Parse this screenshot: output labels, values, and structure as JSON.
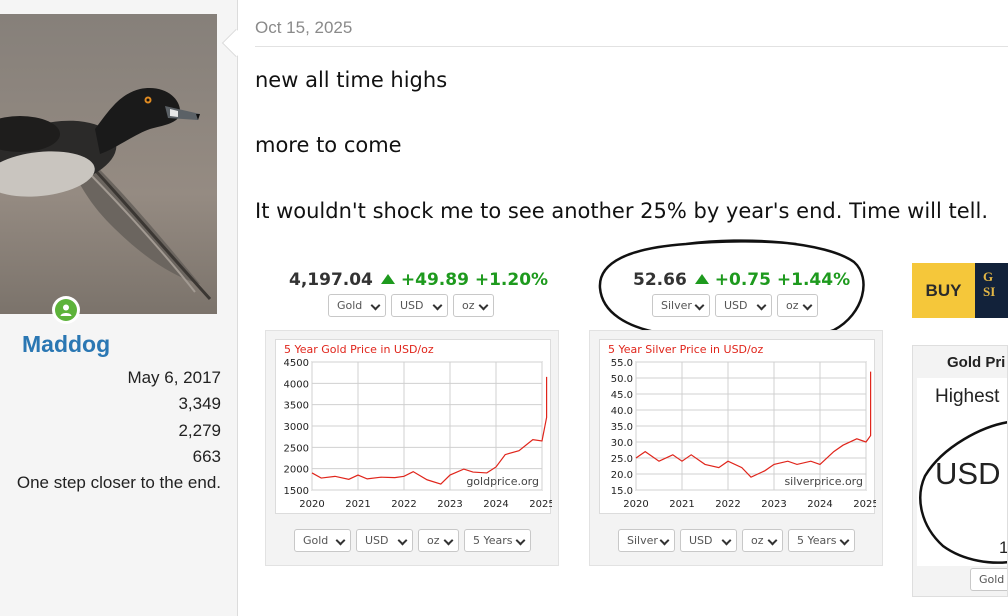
{
  "user": {
    "name": "Maddog",
    "joined": "May 6, 2017",
    "messages": "3,349",
    "reactions": "2,279",
    "points": "663",
    "signature": "One step closer to the end."
  },
  "post": {
    "date": "Oct 15, 2025",
    "lines": [
      "new all time highs",
      "more to come",
      "It wouldn't shock me to see another 25% by year's end. Time will tell."
    ]
  },
  "gold_widget": {
    "price": "4,197.04",
    "change": "+49.89",
    "change_pct": "+1.20%",
    "top_selects": [
      "Gold",
      "USD",
      "oz"
    ],
    "chart_title": "5 Year Gold Price in USD/oz",
    "watermark": "goldprice.org",
    "bottom_selects": [
      "Gold",
      "USD",
      "oz",
      "5 Years"
    ]
  },
  "silver_widget": {
    "price": "52.66",
    "change": "+0.75",
    "change_pct": "+1.44%",
    "top_selects": [
      "Silver",
      "USD",
      "oz"
    ],
    "chart_title": "5 Year Silver Price in USD/oz",
    "watermark": "silverprice.org",
    "bottom_selects": [
      "Silver",
      "USD",
      "oz",
      "5 Years"
    ]
  },
  "promo": {
    "buy_label": "BUY",
    "brand_line1": "G",
    "brand_line2": "SI",
    "gold_price_title": "Gold Pri",
    "highest_label": "Highest",
    "usd_label": "USD",
    "digit_label": "1",
    "select_label": "Gold"
  },
  "colors": {
    "accent_link": "#2a77b3",
    "up_green": "#1e9a1e",
    "chart_red": "#e0251b",
    "online_green": "#5db33a"
  },
  "chart_data": [
    {
      "type": "line",
      "title": "5 Year Gold Price in USD/oz",
      "x_ticks": [
        "2020",
        "2021",
        "2022",
        "2023",
        "2024",
        "2025"
      ],
      "y_ticks": [
        "1500",
        "2000",
        "2500",
        "3000",
        "3500",
        "4000",
        "4500"
      ],
      "xlim": [
        2020,
        2025
      ],
      "ylim": [
        1500,
        4500
      ],
      "grid": true,
      "series": [
        {
          "x": [
            2020.0,
            2020.2,
            2020.5,
            2020.8,
            2021.0,
            2021.2,
            2021.5,
            2021.8,
            2022.0,
            2022.2,
            2022.5,
            2022.8,
            2023.0,
            2023.3,
            2023.5,
            2023.8,
            2024.0,
            2024.2,
            2024.5,
            2024.8,
            2025.0,
            2025.2,
            2025.45,
            2025.6,
            2025.7,
            2025.79
          ],
          "y": [
            1900,
            1780,
            1820,
            1750,
            1850,
            1760,
            1800,
            1790,
            1820,
            1930,
            1740,
            1640,
            1850,
            1990,
            1920,
            1900,
            2040,
            2330,
            2420,
            2680,
            2650,
            3200,
            3350,
            3400,
            3650,
            4150
          ]
        }
      ]
    },
    {
      "type": "line",
      "title": "5 Year Silver Price in USD/oz",
      "x_ticks": [
        "2020",
        "2021",
        "2022",
        "2023",
        "2024",
        "2025"
      ],
      "y_ticks": [
        "15.0",
        "20.0",
        "25.0",
        "30.0",
        "35.0",
        "40.0",
        "45.0",
        "50.0",
        "55.0"
      ],
      "xlim": [
        2020,
        2025
      ],
      "ylim": [
        15,
        55
      ],
      "grid": true,
      "series": [
        {
          "x": [
            2020.0,
            2020.2,
            2020.5,
            2020.8,
            2021.0,
            2021.2,
            2021.5,
            2021.8,
            2022.0,
            2022.3,
            2022.5,
            2022.8,
            2023.0,
            2023.3,
            2023.5,
            2023.8,
            2024.0,
            2024.3,
            2024.5,
            2024.8,
            2025.0,
            2025.2,
            2025.45,
            2025.6,
            2025.7,
            2025.79
          ],
          "y": [
            25,
            27,
            24,
            26,
            24,
            26,
            23,
            22,
            24,
            22,
            19,
            21,
            23,
            24,
            23,
            24,
            23,
            27,
            29,
            31,
            30,
            32,
            34,
            38,
            42,
            52
          ]
        }
      ]
    }
  ]
}
